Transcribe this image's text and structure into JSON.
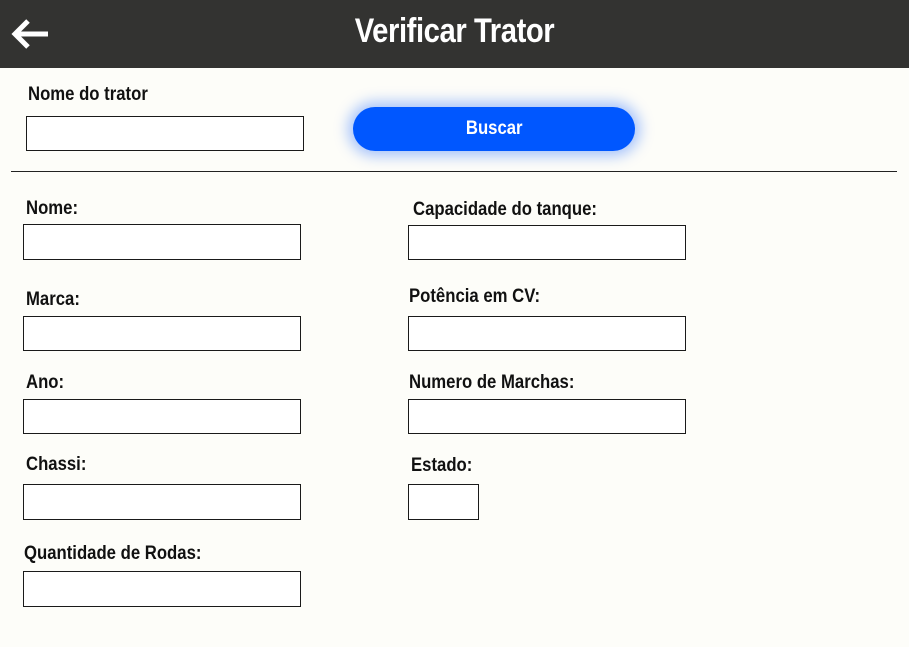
{
  "header": {
    "title": "Verificar Trator",
    "back_icon": "arrow-left-icon"
  },
  "search": {
    "label": "Nome do trator",
    "value": "",
    "button_label": "Buscar",
    "button_color": "#0057ff"
  },
  "form": {
    "nome": {
      "label": "Nome:",
      "value": ""
    },
    "marca": {
      "label": "Marca:",
      "value": ""
    },
    "ano": {
      "label": "Ano:",
      "value": ""
    },
    "chassi": {
      "label": "Chassi:",
      "value": ""
    },
    "quantidade_rodas": {
      "label": "Quantidade de Rodas:",
      "value": ""
    },
    "capacidade_tanque": {
      "label": "Capacidade do tanque:",
      "value": ""
    },
    "potencia_cv": {
      "label": "Potência em CV:",
      "value": ""
    },
    "numero_marchas": {
      "label": "Numero de Marchas:",
      "value": ""
    },
    "estado": {
      "label": "Estado:",
      "value": ""
    }
  },
  "colors": {
    "header_bg": "#333331",
    "page_bg": "#fdfdf9",
    "accent": "#0057ff"
  }
}
